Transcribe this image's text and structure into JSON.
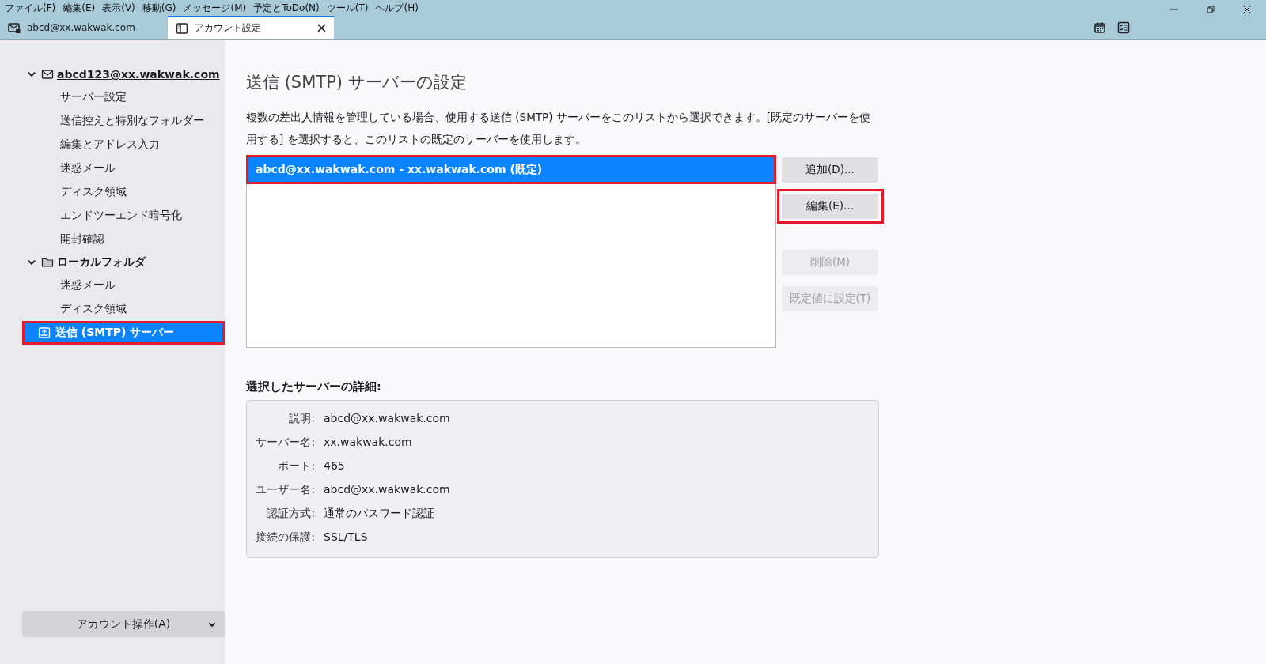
{
  "menu_bar": [
    {
      "label": "ファイル(F)"
    },
    {
      "label": "編集(E)"
    },
    {
      "label": "表示(V)"
    },
    {
      "label": "移動(G)"
    },
    {
      "label": "メッセージ(M)"
    },
    {
      "label": "予定とToDo(N)"
    },
    {
      "label": "ツール(T)"
    },
    {
      "label": "ヘルプ(H)"
    }
  ],
  "tabs": [
    {
      "label": "abcd@xx.wakwak.com",
      "kind": "mail",
      "selected": false,
      "closable": false
    },
    {
      "label": "アカウント設定",
      "kind": "settings",
      "selected": true,
      "closable": true
    }
  ],
  "sidebar": {
    "items": [
      {
        "label": "abcd123@xx.wakwak.com",
        "kind": "account",
        "expanded": true,
        "selected": false,
        "highlighted": false,
        "children": [
          {
            "label": "サーバー設定",
            "selected": false,
            "highlighted": false
          },
          {
            "label": "送信控えと特別なフォルダー",
            "selected": false,
            "highlighted": false
          },
          {
            "label": "編集とアドレス入力",
            "selected": false,
            "highlighted": false
          },
          {
            "label": "迷惑メール",
            "selected": false,
            "highlighted": false
          },
          {
            "label": "ディスク領域",
            "selected": false,
            "highlighted": false
          },
          {
            "label": "エンドツーエンド暗号化",
            "selected": false,
            "highlighted": false
          },
          {
            "label": "開封確認",
            "selected": false,
            "highlighted": false
          }
        ]
      },
      {
        "label": "ローカルフォルダ",
        "kind": "folder",
        "expanded": true,
        "selected": false,
        "highlighted": false,
        "children": [
          {
            "label": "迷惑メール",
            "selected": false,
            "highlighted": false
          },
          {
            "label": "ディスク領域",
            "selected": false,
            "highlighted": false
          }
        ]
      },
      {
        "label": "送信 (SMTP) サーバー",
        "kind": "smtp",
        "selected": true,
        "highlighted": true
      }
    ],
    "account_actions": {
      "label": "アカウント操作(A)"
    }
  },
  "page": {
    "title": "送信 (SMTP) サーバーの設定",
    "description": "複数の差出人情報を管理している場合、使用する送信 (SMTP) サーバーをこのリストから選択できます。[既定のサーバーを使用する] を選択すると、このリストの既定のサーバーを使用します。",
    "servers": [
      {
        "label": "abcd@xx.wakwak.com - xx.wakwak.com (既定)",
        "selected": true,
        "highlighted": true
      }
    ],
    "buttons": [
      {
        "label": "追加(D)...",
        "disabled": false,
        "highlighted": false
      },
      {
        "label": "編集(E)...",
        "disabled": false,
        "highlighted": true
      },
      {
        "label": "削除(M)",
        "disabled": true,
        "highlighted": false
      },
      {
        "label": "既定値に設定(T)",
        "disabled": true,
        "highlighted": false
      }
    ],
    "details_heading": "選択したサーバーの詳細:",
    "details": [
      {
        "label": "説明:",
        "value": "abcd@xx.wakwak.com"
      },
      {
        "label": "サーバー名:",
        "value": "xx.wakwak.com"
      },
      {
        "label": "ポート:",
        "value": "465"
      },
      {
        "label": "ユーザー名:",
        "value": "abcd@xx.wakwak.com"
      },
      {
        "label": "認証方式:",
        "value": "通常のパスワード認証"
      },
      {
        "label": "接続の保護:",
        "value": "SSL/TLS"
      }
    ]
  }
}
